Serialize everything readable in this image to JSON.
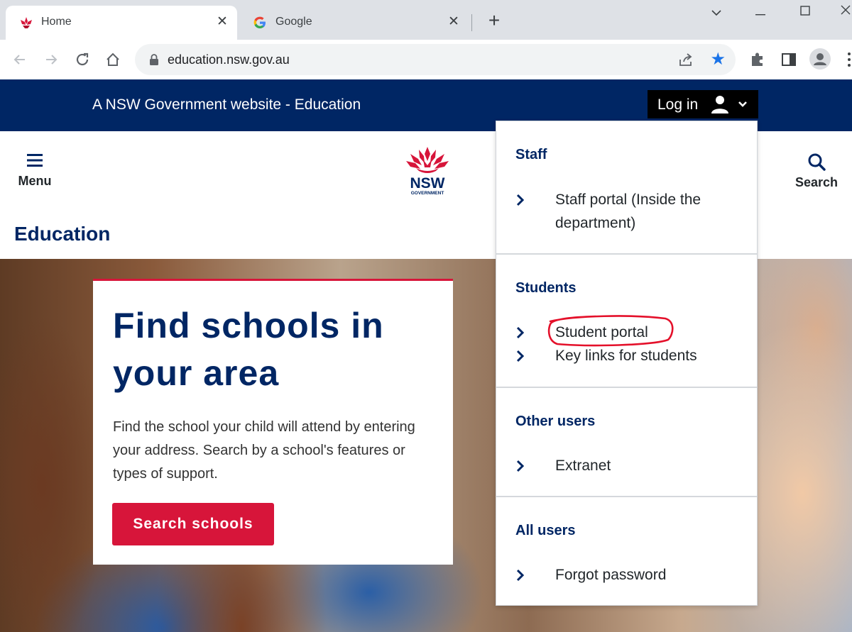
{
  "browser": {
    "tabs": [
      {
        "title": "Home",
        "active": true,
        "favicon": "waratah-icon"
      },
      {
        "title": "Google",
        "active": false,
        "favicon": "google-g-icon"
      }
    ],
    "url": "education.nsw.gov.au"
  },
  "gov_bar": {
    "text": "A NSW Government website - Education",
    "login_label": "Log in"
  },
  "header": {
    "menu_label": "Menu",
    "search_label": "Search",
    "logo_text": "NSW",
    "logo_subtext": "GOVERNMENT",
    "site_title": "Education"
  },
  "hero": {
    "title": "Find schools in your area",
    "description": "Find the school your child will attend by entering your address. Search by a school's features or types of support.",
    "button_label": "Search schools"
  },
  "login_menu": {
    "sections": [
      {
        "heading": "Staff",
        "items": [
          "Staff portal (Inside the department)"
        ]
      },
      {
        "heading": "Students",
        "items": [
          "Student portal",
          "Key links for students"
        ]
      },
      {
        "heading": "Other users",
        "items": [
          "Extranet"
        ]
      },
      {
        "heading": "All users",
        "items": [
          "Forgot password"
        ]
      }
    ]
  },
  "colors": {
    "nsw_navy": "#002664",
    "nsw_red": "#d7153a",
    "chrome_blue": "#1a73e8",
    "annotation_red": "#e4102a"
  }
}
